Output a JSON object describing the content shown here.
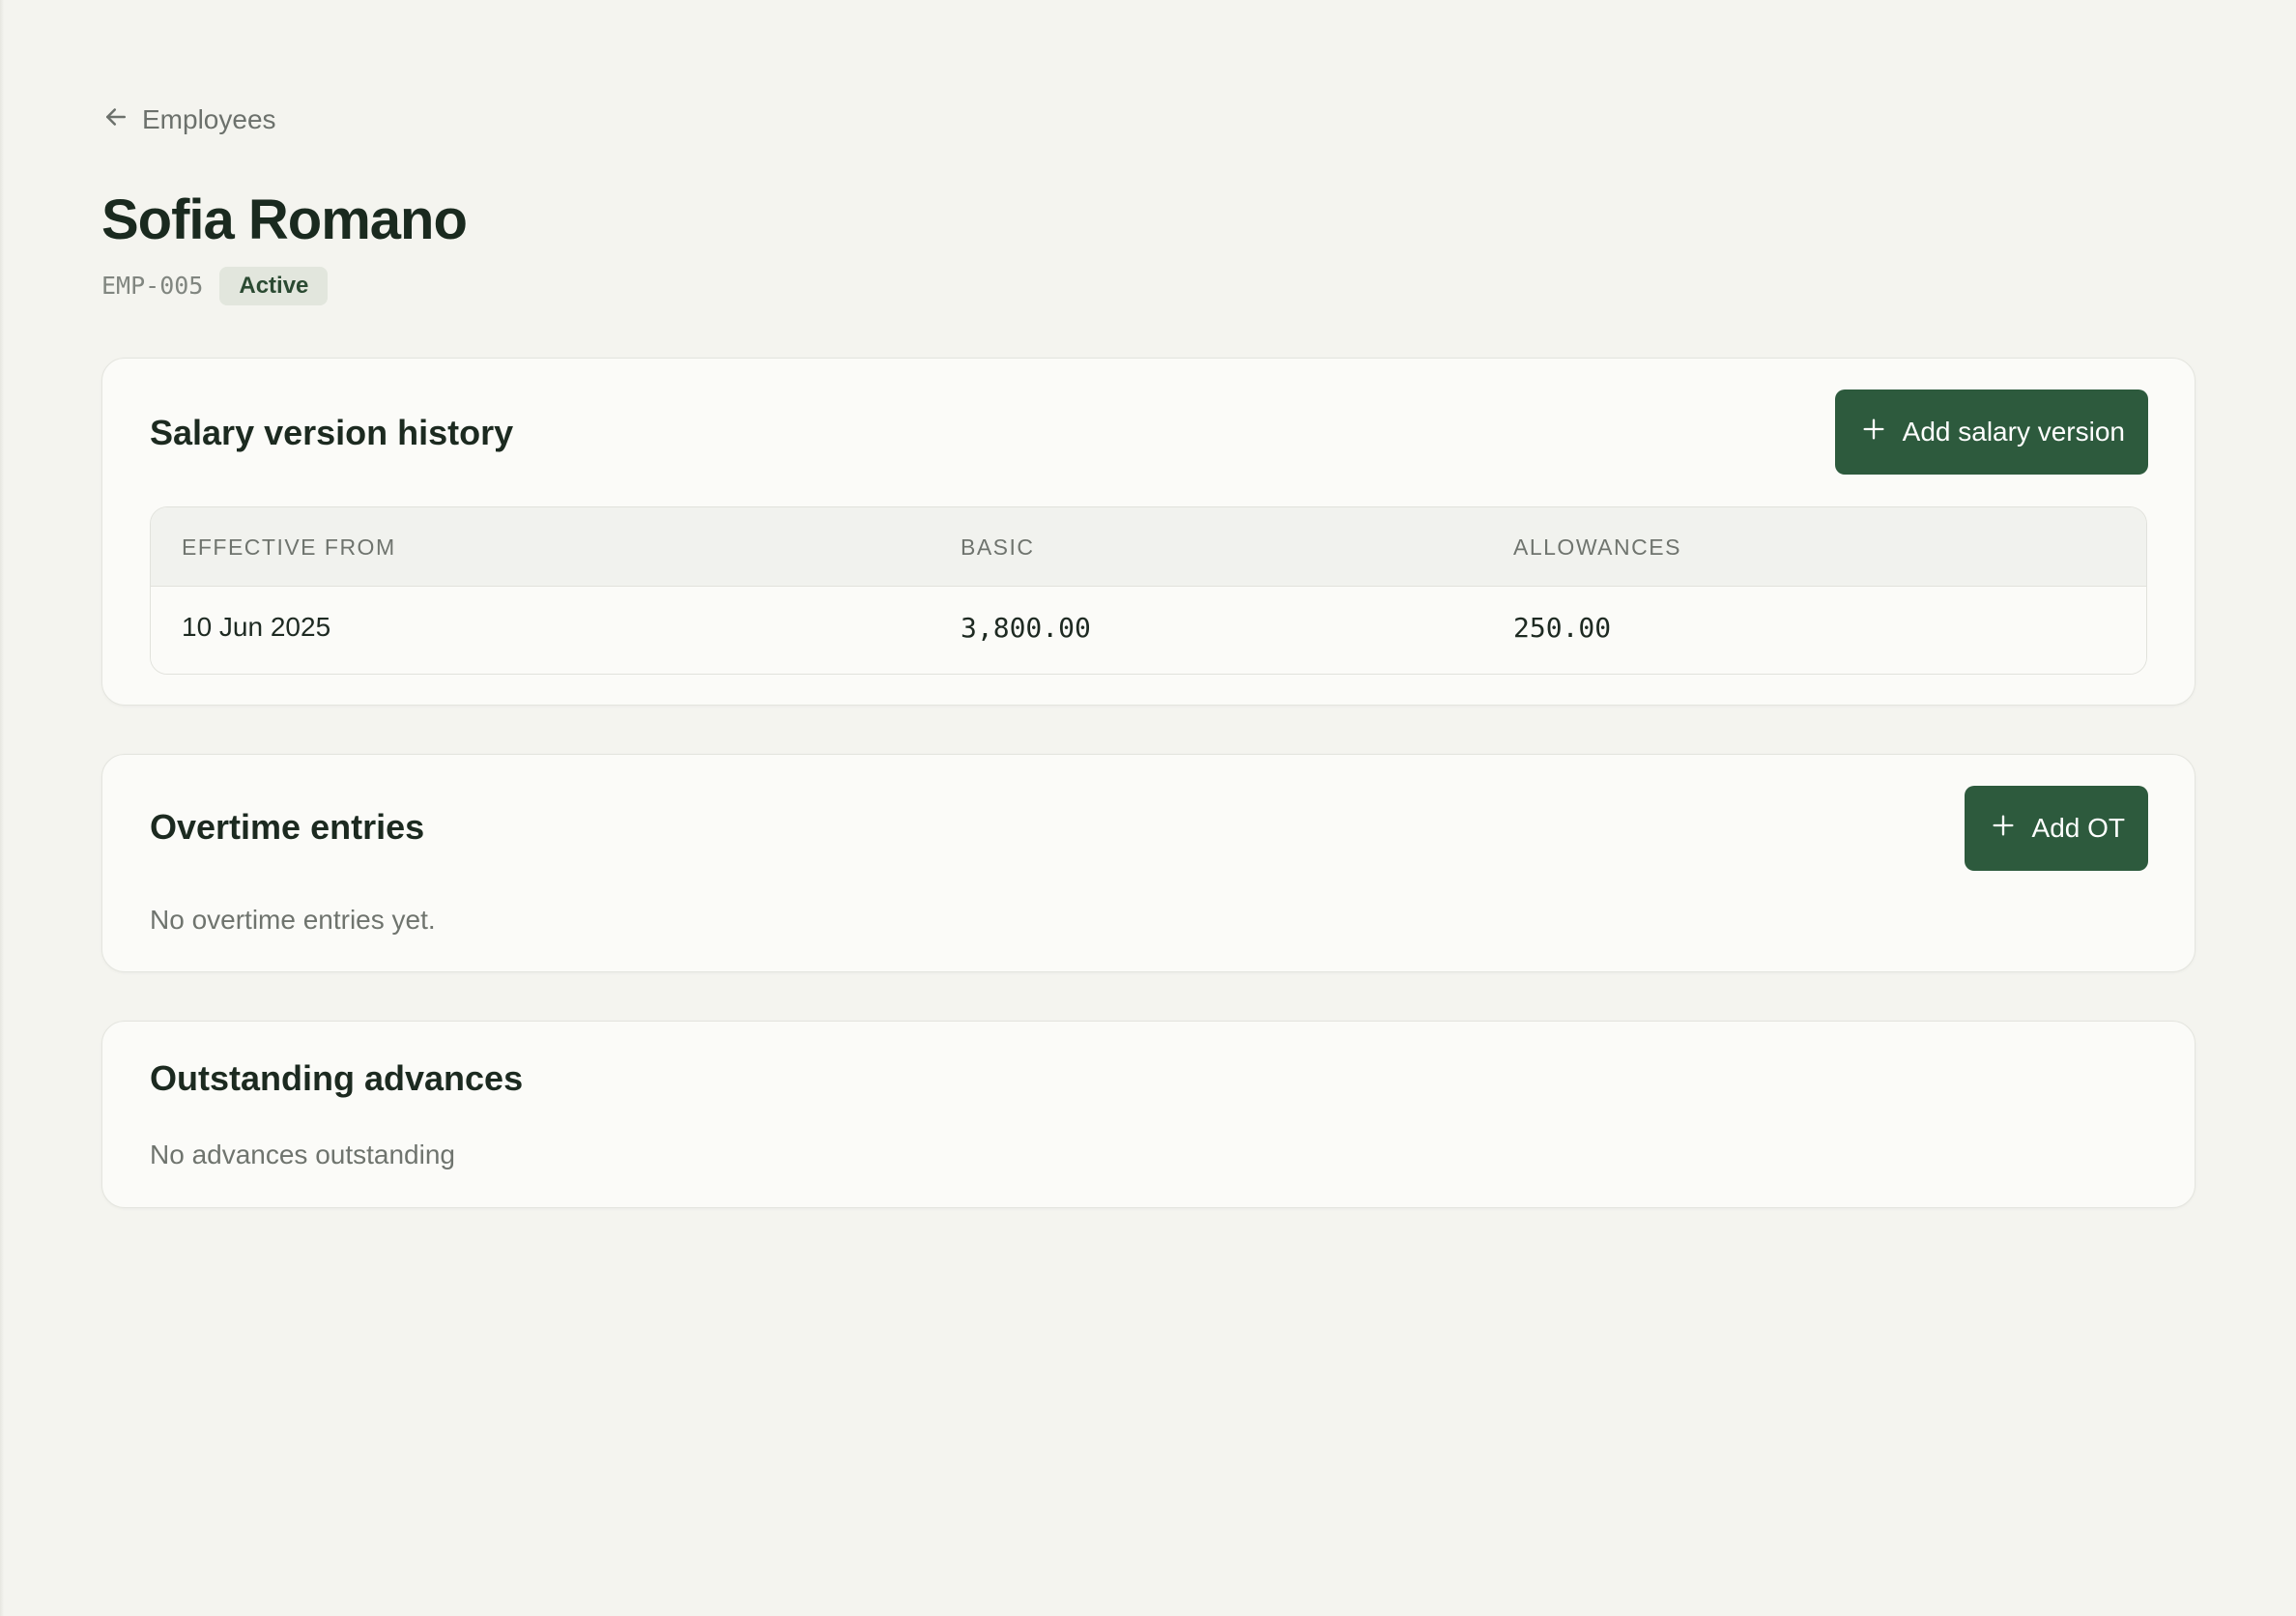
{
  "breadcrumb": {
    "back_label": "Employees"
  },
  "employee": {
    "name": "Sofia Romano",
    "id": "EMP-005",
    "status": "Active"
  },
  "salary": {
    "title": "Salary version history",
    "add_button": "Add salary version",
    "columns": [
      "EFFECTIVE FROM",
      "BASIC",
      "ALLOWANCES"
    ],
    "rows": [
      {
        "effective_from": "10 Jun 2025",
        "basic": "3,800.00",
        "allowances": "250.00"
      }
    ]
  },
  "overtime": {
    "title": "Overtime entries",
    "add_button": "Add OT",
    "empty": "No overtime entries yet."
  },
  "advances": {
    "title": "Outstanding advances",
    "empty": "No advances outstanding"
  },
  "colors": {
    "accent": "#2d5a3d",
    "background": "#f4f4ef",
    "card": "#fbfbf8",
    "badge_bg": "#e2e6dd"
  }
}
